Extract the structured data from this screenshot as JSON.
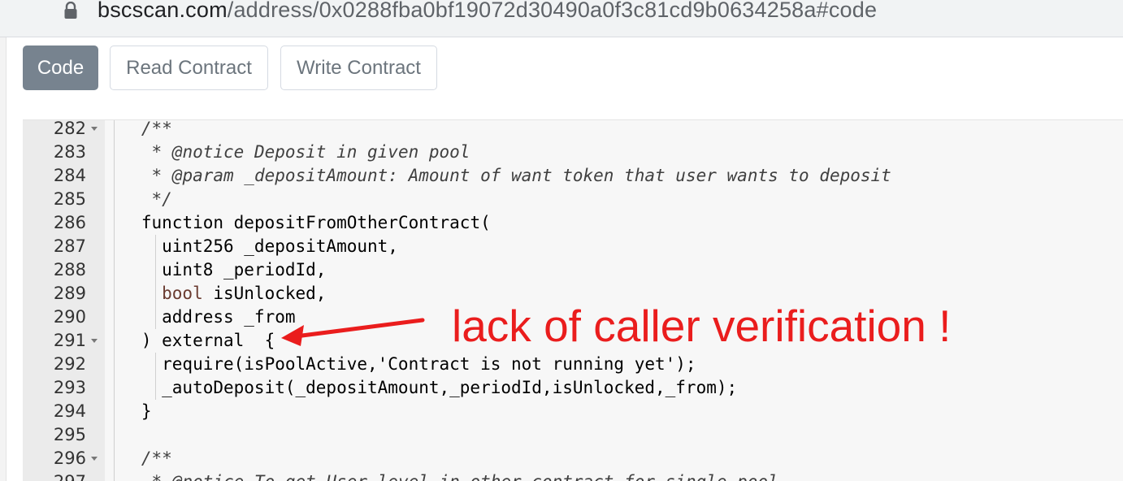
{
  "browser": {
    "url_host": "bscscan.com",
    "url_path": "/address/0x0288fba0bf19072d30490a0f3c81cd9b0634258a#code",
    "lock_icon": "lock-icon"
  },
  "tabs": [
    {
      "label": "Code",
      "active": true
    },
    {
      "label": "Read Contract",
      "active": false
    },
    {
      "label": "Write Contract",
      "active": false
    }
  ],
  "code_lines": [
    {
      "num": "282",
      "fold": true,
      "indent": 3,
      "text": "/**",
      "type": "comment"
    },
    {
      "num": "283",
      "fold": false,
      "indent": 4,
      "text": "* @notice Deposit in given pool",
      "type": "comment"
    },
    {
      "num": "284",
      "fold": false,
      "indent": 4,
      "text": "* @param _depositAmount: Amount of want token that user wants to deposit",
      "type": "comment"
    },
    {
      "num": "285",
      "fold": false,
      "indent": 4,
      "text": "*/",
      "type": "comment"
    },
    {
      "num": "286",
      "fold": false,
      "indent": 3,
      "text": "function depositFromOtherContract(",
      "type": "code"
    },
    {
      "num": "287",
      "fold": false,
      "indent": 5,
      "text": "uint256 _depositAmount,",
      "type": "code"
    },
    {
      "num": "288",
      "fold": false,
      "indent": 5,
      "text": "uint8 _periodId,",
      "type": "code"
    },
    {
      "num": "289",
      "fold": false,
      "indent": 5,
      "text": " isUnlocked,",
      "keyword": "bool",
      "type": "code"
    },
    {
      "num": "290",
      "fold": false,
      "indent": 5,
      "text": "address _from",
      "type": "code"
    },
    {
      "num": "291",
      "fold": true,
      "indent": 3,
      "text": ") external  {",
      "type": "code"
    },
    {
      "num": "292",
      "fold": false,
      "indent": 5,
      "text": "require(isPoolActive,'Contract is not running yet');",
      "type": "code"
    },
    {
      "num": "293",
      "fold": false,
      "indent": 5,
      "text": "_autoDeposit(_depositAmount,_periodId,isUnlocked,_from);",
      "type": "code"
    },
    {
      "num": "294",
      "fold": false,
      "indent": 3,
      "text": "}",
      "type": "code"
    },
    {
      "num": "295",
      "fold": false,
      "indent": 3,
      "text": "",
      "type": "code"
    },
    {
      "num": "296",
      "fold": true,
      "indent": 3,
      "text": "/**",
      "type": "comment"
    },
    {
      "num": "297",
      "fold": false,
      "indent": 4,
      "text": "* @notice To get User level in other contract for single pool",
      "type": "comment"
    }
  ],
  "annotation": {
    "text": "lack of caller verification !",
    "color": "#ea1d1d",
    "arrow_icon": "red-arrow-icon"
  },
  "colors": {
    "active_tab": "#77838f",
    "keyword": "#6a3b30"
  }
}
